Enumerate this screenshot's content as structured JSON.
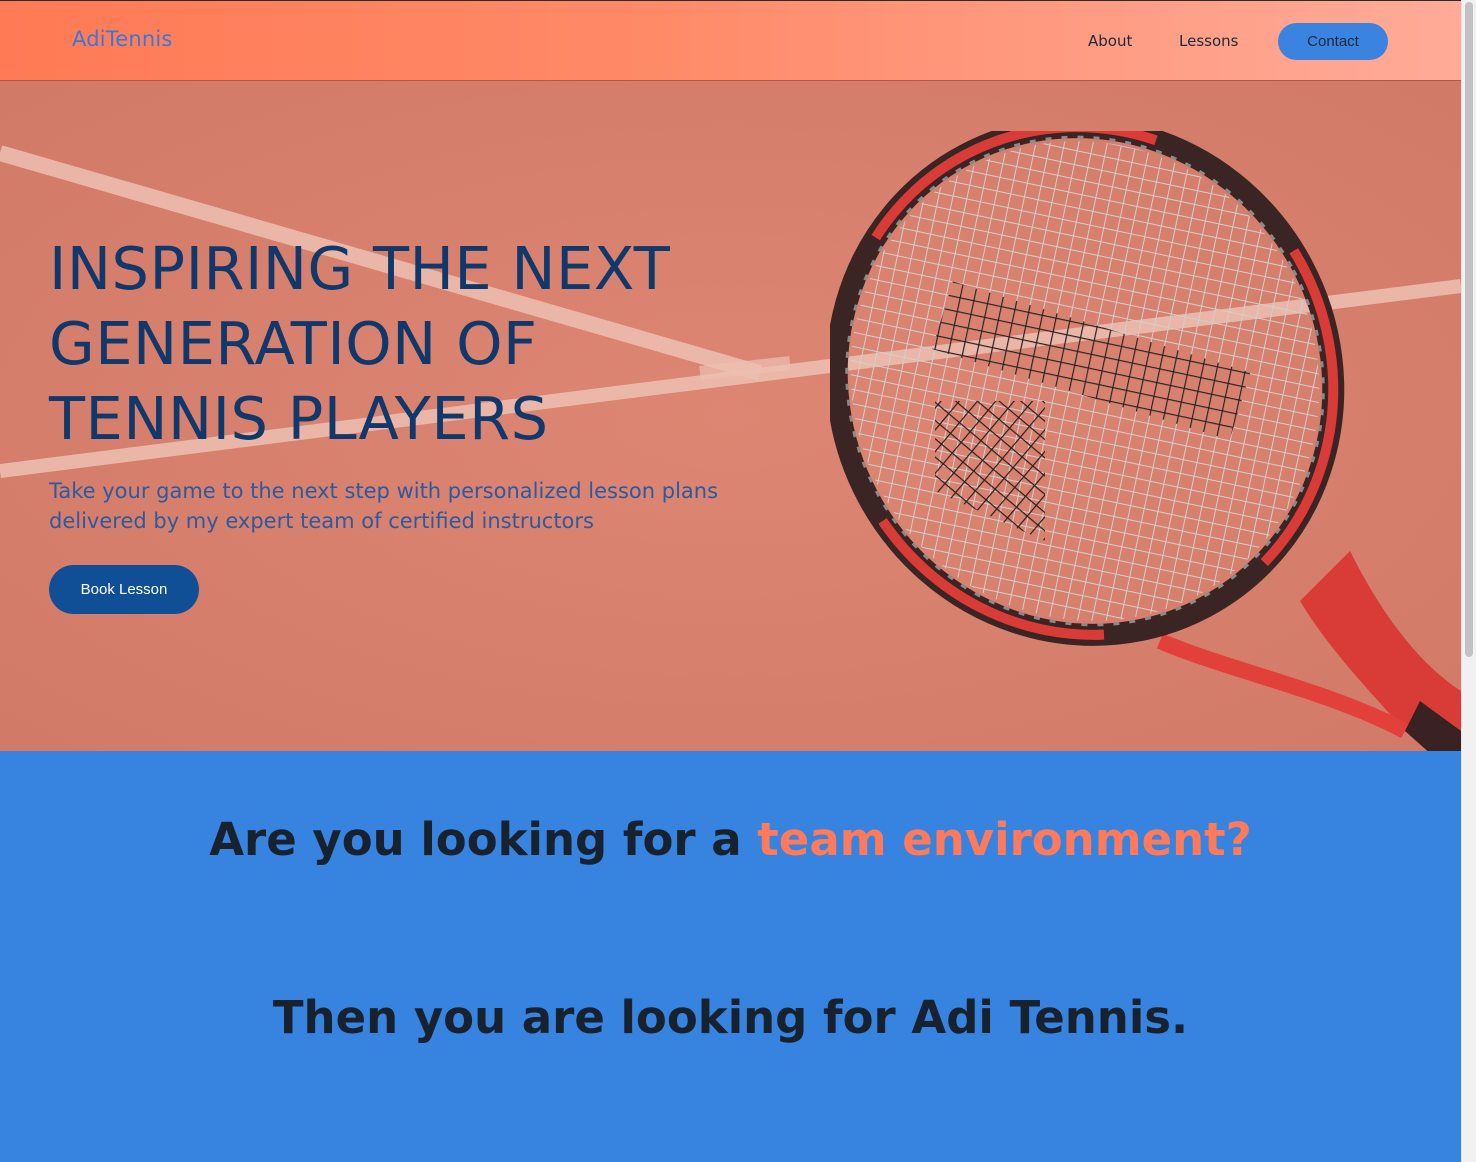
{
  "nav": {
    "brand": "AdiTennis",
    "links": [
      "About",
      "Lessons"
    ],
    "contact": "Contact"
  },
  "hero": {
    "title_lines": [
      "INSPIRING THE NEXT",
      "GENERATION OF",
      "TENNIS PLAYERS"
    ],
    "subtitle_lines": [
      "Take your game to the next step with personalized lesson plans",
      "delivered by my expert team of certified instructors"
    ],
    "cta": "Book Lesson"
  },
  "section": {
    "question_prefix": "Are you looking for a ",
    "question_accent": "team environment?",
    "answer": "Then you are looking for Adi Tennis."
  },
  "colors": {
    "nav_gradient_start": "#ff7a55",
    "nav_gradient_end": "#ffab98",
    "brand": "#3a78d6",
    "contact_button": "#3a83df",
    "hero_background": "#db8270",
    "hero_title": "#11386b",
    "hero_subtitle": "#2c5a9e",
    "book_button": "#104f96",
    "section_background": "#3683e0",
    "accent": "#ff7a5a"
  },
  "icons": {
    "hero_image": "tennis-racket-on-clay-court"
  }
}
